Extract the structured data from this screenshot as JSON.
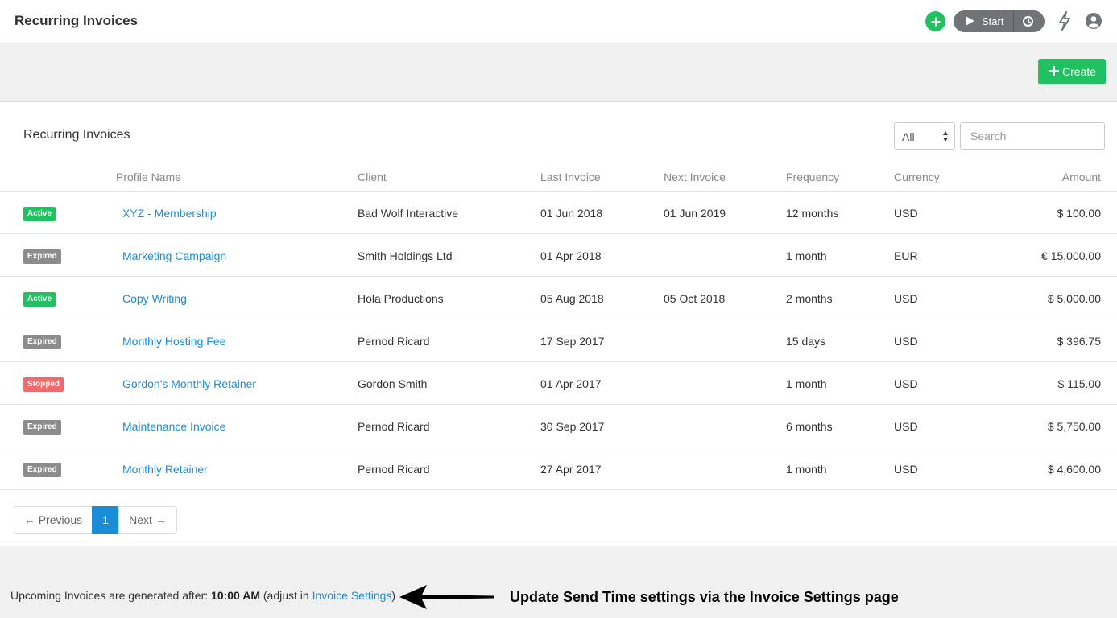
{
  "header": {
    "title": "Recurring Invoices",
    "timer_start_label": "Start"
  },
  "toolbar": {
    "create_label": "Create"
  },
  "panel": {
    "title": "Recurring Invoices",
    "filter_value": "All",
    "search_placeholder": "Search"
  },
  "table": {
    "columns": {
      "profile_name": "Profile Name",
      "client": "Client",
      "last_invoice": "Last Invoice",
      "next_invoice": "Next Invoice",
      "frequency": "Frequency",
      "currency": "Currency",
      "amount": "Amount"
    },
    "rows": [
      {
        "status": "Active",
        "profile": "XYZ - Membership",
        "client": "Bad Wolf Interactive",
        "last": "01 Jun 2018",
        "next": "01 Jun 2019",
        "frequency": "12 months",
        "currency": "USD",
        "amount": "$ 100.00"
      },
      {
        "status": "Expired",
        "profile": "Marketing Campaign",
        "client": "Smith Holdings Ltd",
        "last": "01 Apr 2018",
        "next": "",
        "frequency": "1 month",
        "currency": "EUR",
        "amount": "€ 15,000.00"
      },
      {
        "status": "Active",
        "profile": "Copy Writing",
        "client": "Hola Productions",
        "last": "05 Aug 2018",
        "next": "05 Oct 2018",
        "frequency": "2 months",
        "currency": "USD",
        "amount": "$ 5,000.00"
      },
      {
        "status": "Expired",
        "profile": "Monthly Hosting Fee",
        "client": "Pernod Ricard",
        "last": "17 Sep 2017",
        "next": "",
        "frequency": "15 days",
        "currency": "USD",
        "amount": "$ 396.75"
      },
      {
        "status": "Stopped",
        "profile": "Gordon's Monthly Retainer",
        "client": "Gordon Smith",
        "last": "01 Apr 2017",
        "next": "",
        "frequency": "1 month",
        "currency": "USD",
        "amount": "$ 115.00"
      },
      {
        "status": "Expired",
        "profile": "Maintenance Invoice",
        "client": "Pernod Ricard",
        "last": "30 Sep 2017",
        "next": "",
        "frequency": "6 months",
        "currency": "USD",
        "amount": "$ 5,750.00"
      },
      {
        "status": "Expired",
        "profile": "Monthly Retainer",
        "client": "Pernod Ricard",
        "last": "27 Apr 2017",
        "next": "",
        "frequency": "1 month",
        "currency": "USD",
        "amount": "$ 4,600.00"
      }
    ]
  },
  "pagination": {
    "previous_label": "← Previous",
    "current_page": "1",
    "next_label": "Next →"
  },
  "footer": {
    "note_prefix": "Upcoming Invoices are generated after: ",
    "time": "10:00 AM",
    "adjust_prefix": " (adjust in ",
    "settings_link": "Invoice Settings",
    "adjust_suffix": ")",
    "callout": "Update Send Time settings via the Invoice Settings page"
  },
  "colors": {
    "accent_green": "#21c162",
    "link_blue": "#1a8dd8",
    "status_active": "#21c162",
    "status_expired": "#8c8c8c",
    "status_stopped": "#f06a6a"
  },
  "icons": {
    "add": "plus-circle-icon",
    "timer_play": "play-icon",
    "timer_history": "clock-icon",
    "notifications": "bolt-icon",
    "account": "user-icon"
  }
}
